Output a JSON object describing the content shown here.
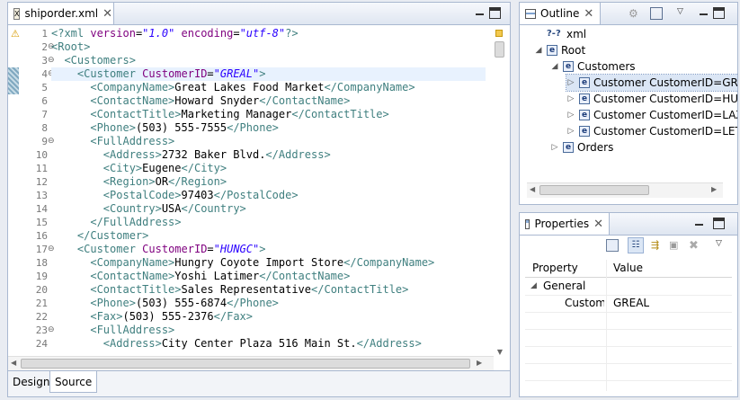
{
  "editor": {
    "tab_title": "shiporder.xml",
    "bottom_tabs": [
      "Design",
      "Source"
    ],
    "lines": [
      {
        "n": "1",
        "fold": "",
        "html": "<span class='pi'>&lt;?xml</span> <span class='a'>version</span>=<span class='v'>\"1.0\"</span> <span class='a'>encoding</span>=<span class='v'>\"utf-8\"</span><span class='pi'>?&gt;</span>"
      },
      {
        "n": "2",
        "fold": "⊖",
        "html": "<span class='t'>&lt;Root&gt;</span>"
      },
      {
        "n": "3",
        "fold": "⊖",
        "html": "  <span class='t'>&lt;Customers&gt;</span>"
      },
      {
        "n": "4",
        "fold": "⊖",
        "html": "    <span class='t'>&lt;Customer</span> <span class='a'>CustomerID</span>=<span class='v'>\"GREAL\"</span><span class='t'>&gt;</span>"
      },
      {
        "n": "5",
        "fold": "",
        "html": "      <span class='t'>&lt;CompanyName&gt;</span>Great Lakes Food Market<span class='t'>&lt;/CompanyName&gt;</span>"
      },
      {
        "n": "6",
        "fold": "",
        "html": "      <span class='t'>&lt;ContactName&gt;</span>Howard Snyder<span class='t'>&lt;/ContactName&gt;</span>"
      },
      {
        "n": "7",
        "fold": "",
        "html": "      <span class='t'>&lt;ContactTitle&gt;</span>Marketing Manager<span class='t'>&lt;/ContactTitle&gt;</span>"
      },
      {
        "n": "8",
        "fold": "",
        "html": "      <span class='t'>&lt;Phone&gt;</span>(503) 555-7555<span class='t'>&lt;/Phone&gt;</span>"
      },
      {
        "n": "9",
        "fold": "⊖",
        "html": "      <span class='t'>&lt;FullAddress&gt;</span>"
      },
      {
        "n": "10",
        "fold": "",
        "html": "        <span class='t'>&lt;Address&gt;</span>2732 Baker Blvd.<span class='t'>&lt;/Address&gt;</span>"
      },
      {
        "n": "11",
        "fold": "",
        "html": "        <span class='t'>&lt;City&gt;</span>Eugene<span class='t'>&lt;/City&gt;</span>"
      },
      {
        "n": "12",
        "fold": "",
        "html": "        <span class='t'>&lt;Region&gt;</span>OR<span class='t'>&lt;/Region&gt;</span>"
      },
      {
        "n": "13",
        "fold": "",
        "html": "        <span class='t'>&lt;PostalCode&gt;</span>97403<span class='t'>&lt;/PostalCode&gt;</span>"
      },
      {
        "n": "14",
        "fold": "",
        "html": "        <span class='t'>&lt;Country&gt;</span>USA<span class='t'>&lt;/Country&gt;</span>"
      },
      {
        "n": "15",
        "fold": "",
        "html": "      <span class='t'>&lt;/FullAddress&gt;</span>"
      },
      {
        "n": "16",
        "fold": "",
        "html": "    <span class='t'>&lt;/Customer&gt;</span>"
      },
      {
        "n": "17",
        "fold": "⊖",
        "html": "    <span class='t'>&lt;Customer</span> <span class='a'>CustomerID</span>=<span class='v'>\"HUNGC\"</span><span class='t'>&gt;</span>"
      },
      {
        "n": "18",
        "fold": "",
        "html": "      <span class='t'>&lt;CompanyName&gt;</span>Hungry Coyote Import Store<span class='t'>&lt;/CompanyName&gt;</span>"
      },
      {
        "n": "19",
        "fold": "",
        "html": "      <span class='t'>&lt;ContactName&gt;</span>Yoshi Latimer<span class='t'>&lt;/ContactName&gt;</span>"
      },
      {
        "n": "20",
        "fold": "",
        "html": "      <span class='t'>&lt;ContactTitle&gt;</span>Sales Representative<span class='t'>&lt;/ContactTitle&gt;</span>"
      },
      {
        "n": "21",
        "fold": "",
        "html": "      <span class='t'>&lt;Phone&gt;</span>(503) 555-6874<span class='t'>&lt;/Phone&gt;</span>"
      },
      {
        "n": "22",
        "fold": "",
        "html": "      <span class='t'>&lt;Fax&gt;</span>(503) 555-2376<span class='t'>&lt;/Fax&gt;</span>"
      },
      {
        "n": "23",
        "fold": "⊖",
        "html": "      <span class='t'>&lt;FullAddress&gt;</span>"
      },
      {
        "n": "24",
        "fold": "",
        "html": "        <span class='t'>&lt;Address&gt;</span>City Center Plaza 516 Main St.<span class='t'>&lt;/Address&gt;</span>"
      }
    ]
  },
  "outline": {
    "title": "Outline",
    "items": [
      {
        "label": "xml",
        "kind": "pi",
        "twisty": ""
      },
      {
        "label": "Root",
        "kind": "e",
        "twisty": "◢"
      },
      {
        "label": "Customers",
        "kind": "e",
        "twisty": "◢"
      },
      {
        "label": "Customer CustomerID=GREAL",
        "kind": "e",
        "twisty": "▷"
      },
      {
        "label": "Customer CustomerID=HUNGC",
        "kind": "e",
        "twisty": "▷"
      },
      {
        "label": "Customer CustomerID=LAZYK",
        "kind": "e",
        "twisty": "▷"
      },
      {
        "label": "Customer CustomerID=LETSS",
        "kind": "e",
        "twisty": "▷"
      },
      {
        "label": "Orders",
        "kind": "e",
        "twisty": "▷"
      }
    ]
  },
  "properties": {
    "title": "Properties",
    "col_property": "Property",
    "col_value": "Value",
    "category": "General",
    "rows": [
      {
        "name": "CustomerID",
        "value": "GREAL"
      }
    ]
  },
  "colors": {
    "tag": "#3f7f7f",
    "attr": "#7f007f",
    "value": "#2a00ff",
    "current_line": "#e8f2fe"
  }
}
